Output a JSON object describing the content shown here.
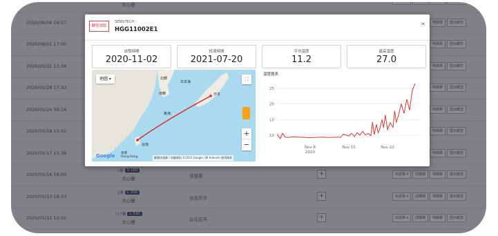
{
  "table": {
    "rows": [
      {
        "date": "",
        "cell2_sub": "文心聲",
        "cell3": "",
        "badge": "",
        "badge_prefix": "",
        "show_btns": false
      },
      {
        "date": "2020/06/06 16:57",
        "cell2_sub": "",
        "cell3": "",
        "badge": "",
        "badge_prefix": "",
        "show_btns": false
      },
      {
        "date": "2020/06/01 17:00",
        "cell2_sub": "",
        "cell3": "",
        "badge": "",
        "badge_prefix": "",
        "show_btns": false
      },
      {
        "date": "2020/05/31 13:34",
        "cell2_sub": "",
        "cell3": "",
        "badge": "",
        "badge_prefix": "",
        "show_btns": false
      },
      {
        "date": "2020/05/28 17:33",
        "cell2_sub": "",
        "cell3": "",
        "badge": "",
        "badge_prefix": "",
        "show_btns": false
      },
      {
        "date": "2020/05/24 09:14",
        "cell2_sub": "",
        "cell3": "",
        "badge": "",
        "badge_prefix": "",
        "show_btns": false
      },
      {
        "date": "2020/05/18 15:02",
        "cell2_sub": "",
        "cell3": "",
        "badge": "",
        "badge_prefix": "",
        "show_btns": false
      },
      {
        "date": "2020/05/17 15:36",
        "cell2_sub": "文心聲",
        "cell3": "",
        "badge": "",
        "badge_prefix": "",
        "show_btns": false
      },
      {
        "date": "2020/05/16 18:00",
        "cell2_sub": "文心聲",
        "cell3": "佳發署",
        "badge": "S 160",
        "badge_prefix": "1筆",
        "show_btns": true
      },
      {
        "date": "2020/05/13 18:33",
        "cell2_sub": "文心聲",
        "cell3": "台北花市",
        "badge": "L 330",
        "badge_prefix": "2筆",
        "show_btns": true
      },
      {
        "date": "2020/05/11 12:02",
        "cell2_sub": "文心聲",
        "cell3": "台北花市",
        "badge": "L 330",
        "badge_prefix": "717筆",
        "show_btns": true
      }
    ],
    "row_buttons": [
      "出貨單 ▾",
      "詳細單",
      "明細單",
      "匯出報告"
    ]
  },
  "modal": {
    "status_badge": "轉發領取",
    "brand": "SENSITECH",
    "device_id": "HGG11002E1",
    "close": "×",
    "stats": [
      {
        "label": "出發時間",
        "value": "2020-11-02"
      },
      {
        "label": "抵達時間",
        "value": "2021-07-20"
      },
      {
        "label": "平均溫度",
        "value": "11.2"
      },
      {
        "label": "最高溫度",
        "value": "27.0"
      }
    ]
  },
  "map": {
    "map_type": "地圖 ▾",
    "fullscreen": "⛶",
    "zoom_in": "+",
    "zoom_out": "−",
    "google": "Google",
    "attribution": "鍵盤快速鍵 | 地圖資料 ©2021 Google, SK telecom   使用條款",
    "labels": [
      "北韓",
      "南韓",
      "日本",
      "日本海",
      "東海",
      "台灣",
      "Hong Kong",
      "香港"
    ]
  },
  "chart_title": "溫度圖表",
  "chart_data": {
    "type": "line",
    "title": "溫度圖表",
    "xlabel": "",
    "ylabel": "",
    "ylim": [
      8,
      27
    ],
    "yticks": [
      10,
      15,
      20,
      25
    ],
    "xticks": [
      "Nov 8\n2020",
      "Nov 15",
      "Nov 22"
    ],
    "xtick_positions": [
      8,
      15,
      22
    ],
    "xlim": [
      2,
      28
    ],
    "grid": true,
    "series": [
      {
        "color": "#e03232",
        "x": [
          2,
          2.6,
          3,
          3.5,
          4,
          5,
          6,
          7,
          8,
          9,
          10,
          11,
          12,
          13,
          13.5,
          14,
          15,
          15.5,
          16,
          16.5,
          17,
          17.5,
          18,
          18.5,
          19,
          19.3,
          19.6,
          20,
          20.3,
          20.6,
          21,
          21.3,
          21.6,
          22,
          22.5,
          23,
          23.3,
          23.6,
          24,
          24.5,
          25,
          25.5,
          26,
          26.5,
          27
        ],
        "y": [
          10.3,
          8.9,
          10.6,
          9.4,
          9.3,
          9.5,
          9.4,
          9.3,
          9.2,
          9.3,
          9.4,
          9.3,
          9.3,
          9.4,
          9.3,
          10.3,
          9.8,
          10.6,
          9.6,
          10.8,
          10.0,
          11.2,
          10.1,
          10.6,
          9.8,
          14.2,
          10.2,
          13.5,
          10.8,
          12.0,
          15.0,
          12.4,
          16.5,
          11.8,
          14.0,
          12.5,
          17.8,
          14.0,
          16.5,
          20.0,
          17.0,
          21.5,
          18.0,
          24.5,
          26.5
        ]
      }
    ]
  }
}
